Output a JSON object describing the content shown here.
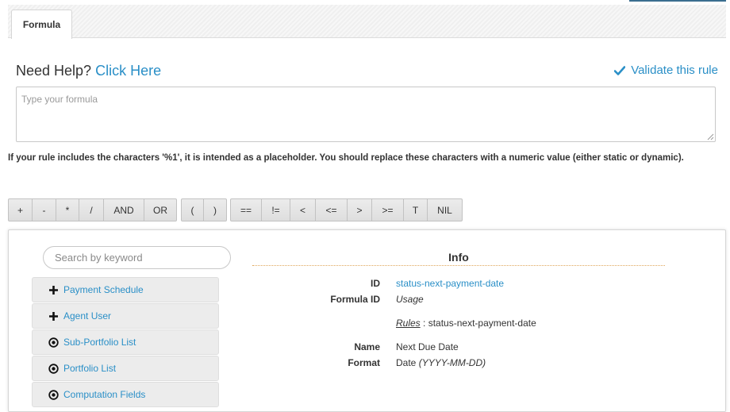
{
  "tab": {
    "label": "Formula"
  },
  "help": {
    "prefix": "Need Help?",
    "link": "Click Here"
  },
  "validate": {
    "label": "Validate this rule"
  },
  "formula": {
    "placeholder": "Type your formula",
    "value": ""
  },
  "note": "If your rule includes the characters '%1', it is intended as a placeholder. You should replace these characters with a numeric value (either static or dynamic).",
  "operators": {
    "arith": [
      "+",
      "-",
      "*",
      "/",
      "AND",
      "OR"
    ],
    "parens": [
      "(",
      ")"
    ],
    "compare": [
      "==",
      "!=",
      "<",
      "<=",
      ">",
      ">=",
      "T",
      "NIL"
    ]
  },
  "search": {
    "placeholder": "Search by keyword"
  },
  "tree": [
    {
      "label": "Payment Schedule",
      "icon": "plus-icon"
    },
    {
      "label": "Agent User",
      "icon": "plus-icon"
    },
    {
      "label": "Sub-Portfolio List",
      "icon": "target-icon"
    },
    {
      "label": "Portfolio List",
      "icon": "target-icon"
    },
    {
      "label": "Computation Fields",
      "icon": "target-icon"
    }
  ],
  "info": {
    "title": "Info",
    "id_label": "ID",
    "id_value": "status-next-payment-date",
    "formula_id_label": "Formula ID",
    "usage": "Usage",
    "rules_label": "Rules",
    "rules_sep": " : ",
    "rules_value": "status-next-payment-date",
    "name_label": "Name",
    "name_value": "Next Due Date",
    "format_label": "Format",
    "format_type": "Date",
    "format_pattern": "(YYYY-MM-DD)"
  },
  "colors": {
    "link": "#2a8fc7",
    "accent_line": "#e0a65a"
  }
}
